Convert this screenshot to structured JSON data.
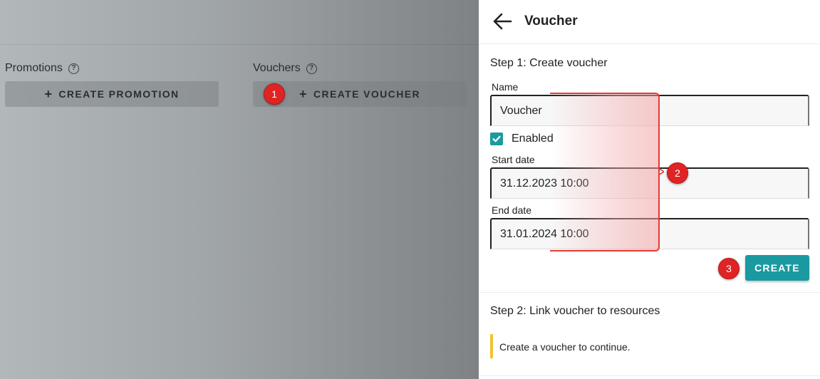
{
  "background": {
    "promotions": {
      "label": "Promotions",
      "button_label": "CREATE PROMOTION"
    },
    "vouchers": {
      "label": "Vouchers",
      "button_label": "CREATE VOUCHER"
    }
  },
  "panel": {
    "title": "Voucher",
    "step1": {
      "title": "Step 1: Create voucher",
      "name_label": "Name",
      "name_value": "Voucher",
      "enabled_label": "Enabled",
      "enabled_checked": true,
      "start_label": "Start date",
      "start_value": "31.12.2023 10:00",
      "end_label": "End date",
      "end_value": "31.01.2024 10:00",
      "create_label": "CREATE"
    },
    "step2": {
      "title": "Step 2: Link voucher to resources",
      "notice": "Create a voucher to continue."
    }
  },
  "annotations": {
    "badge1": "1",
    "badge2": "2",
    "badge3": "3"
  },
  "colors": {
    "accent": "#1a9aa0",
    "badge": "#e02424",
    "notice_bar": "#f2c230"
  },
  "icons": {
    "back": "arrow-left-icon",
    "help": "help-circle-icon",
    "plus": "plus-icon",
    "check": "check-icon"
  }
}
